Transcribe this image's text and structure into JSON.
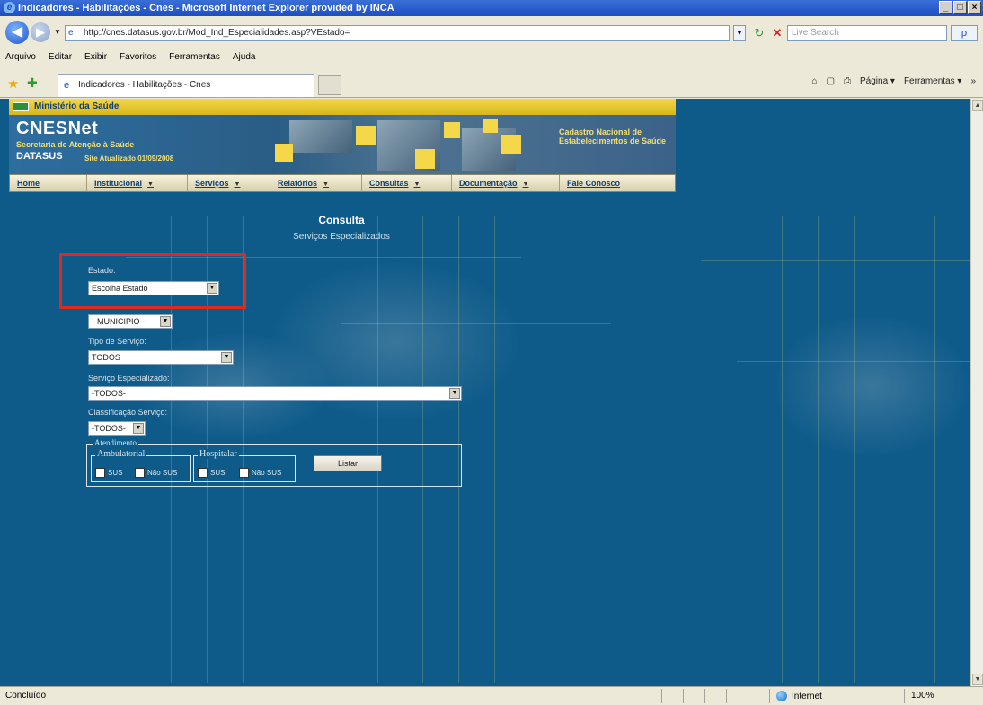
{
  "window": {
    "title": "Indicadores - Habilitações - Cnes - Microsoft Internet Explorer provided by INCA",
    "controls": [
      "_",
      "□",
      "×"
    ]
  },
  "toolbar": {
    "address": "http://cnes.datasus.gov.br/Mod_Ind_Especialidades.asp?VEstado=",
    "search_placeholder": "Live Search",
    "search_go": "ρ"
  },
  "menu": [
    "Arquivo",
    "Editar",
    "Exibir",
    "Favoritos",
    "Ferramentas",
    "Ajuda"
  ],
  "tab": {
    "title": "Indicadores - Habilitações - Cnes"
  },
  "commandbar": {
    "home": "⌂",
    "feeds": "▢",
    "print": "⎙",
    "page": "Página ▾",
    "tools": "Ferramentas ▾",
    "more": "»"
  },
  "site": {
    "ministerio": "Ministério da Saúde",
    "logo_title": "CNESNet",
    "secretaria": "Secretaria de Atenção à Saúde",
    "datasus": "DATASUS",
    "atualizado": "Site Atualizado 01/09/2008",
    "cadastro": "Cadastro Nacional de Estabelecimentos de Saúde",
    "nav": [
      "Home",
      "Institucional",
      "Serviços",
      "Relatórios",
      "Consultas",
      "Documentação",
      "Fale Conosco"
    ]
  },
  "form": {
    "title": "Consulta",
    "subtitle": "Serviços Especializados",
    "estado_label": "Estado:",
    "estado_value": "Escolha Estado",
    "municipio_value": "--MUNICIPIO--",
    "tipo_label": "Tipo de Serviço:",
    "tipo_value": "TODOS",
    "servico_label": "Serviço Especializado:",
    "servico_value": "-TODOS-",
    "classificacao_label": "Classificação Serviço:",
    "classificacao_value": "-TODOS-",
    "atendimento_legend": "Atendimento",
    "ambulatorial": "Ambulatorial",
    "hospitalar": "Hospitalar",
    "sus": "SUS",
    "nao_sus": "Não SUS",
    "listar": "Listar"
  },
  "status": {
    "text": "Concluído",
    "zone": "Internet",
    "zoom": "100%"
  }
}
